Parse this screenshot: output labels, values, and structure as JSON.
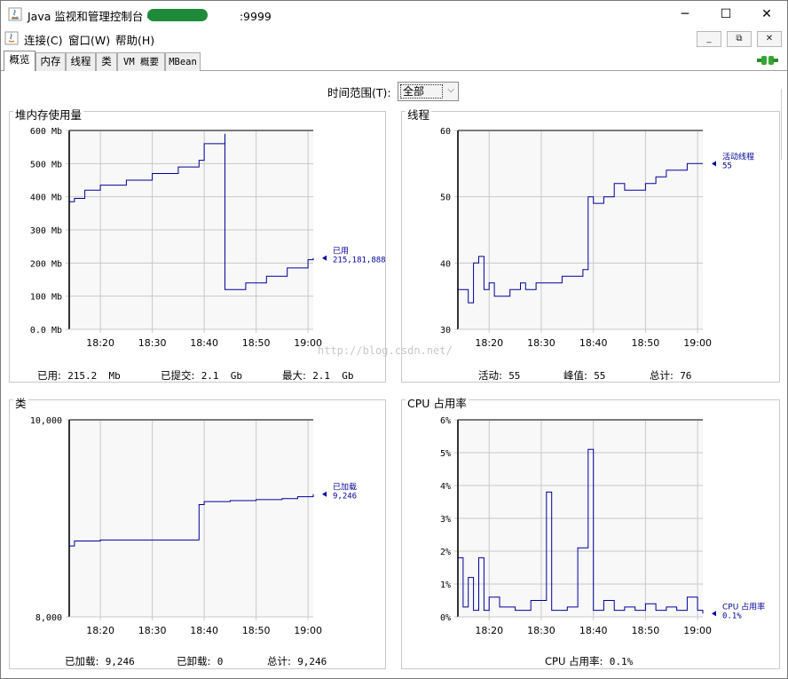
{
  "window": {
    "title": "Java 监视和管理控制台 - ",
    "title_suffix": ":9999",
    "minimize_glyph": "─",
    "maximize_glyph": "☐",
    "close_glyph": "✕"
  },
  "menu": {
    "items": [
      {
        "label": "连接(C)"
      },
      {
        "label": "窗口(W)"
      },
      {
        "label": "帮助(H)"
      }
    ],
    "inner_buttons": [
      "_",
      "⧉",
      "✕"
    ]
  },
  "tabs": [
    {
      "label": "概览",
      "active": true
    },
    {
      "label": "内存",
      "active": false
    },
    {
      "label": "线程",
      "active": false
    },
    {
      "label": "类",
      "active": false
    },
    {
      "label": "VM 概要",
      "active": false
    },
    {
      "label": "MBean",
      "active": false
    }
  ],
  "time_range": {
    "label": "时间范围(T):",
    "value": "全部"
  },
  "watermark": "http://blog.csdn.net/",
  "panels": {
    "heap": {
      "title": "堆内存使用量",
      "stats": [
        {
          "label": "已用:",
          "value": "215.2  Mb"
        },
        {
          "label": "已提交:",
          "value": "2.1  Gb"
        },
        {
          "label": "最大:",
          "value": "2.1  Gb"
        }
      ]
    },
    "threads": {
      "title": "线程",
      "stats": [
        {
          "label": "活动:",
          "value": "55"
        },
        {
          "label": "峰值:",
          "value": "55"
        },
        {
          "label": "总计:",
          "value": "76"
        }
      ]
    },
    "classes": {
      "title": "类",
      "stats": [
        {
          "label": "已加载:",
          "value": "9,246"
        },
        {
          "label": "已卸载:",
          "value": "0"
        },
        {
          "label": "总计:",
          "value": "9,246"
        }
      ]
    },
    "cpu": {
      "title": "CPU 占用率",
      "stats": [
        {
          "label": "CPU 占用率:",
          "value": "0.1%"
        }
      ]
    }
  },
  "chart_data": [
    {
      "type": "line",
      "title": "堆内存使用量",
      "xlabel": "",
      "ylabel": "",
      "x_ticks": [
        "18:20",
        "18:30",
        "18:40",
        "18:50",
        "19:00"
      ],
      "x_range": [
        "18:14",
        "19:01"
      ],
      "y_ticks": [
        "0.0 Mb",
        "100 Mb",
        "200 Mb",
        "300 Mb",
        "400 Mb",
        "500 Mb",
        "600 Mb"
      ],
      "ylim": [
        0,
        600
      ],
      "grid": true,
      "series": [
        {
          "name": "已用",
          "value_label": "215,181,888",
          "color": "#000099",
          "x": [
            "18:14",
            "18:15",
            "18:17",
            "18:20",
            "18:25",
            "18:30",
            "18:35",
            "18:39",
            "18:40",
            "18:44",
            "18:44",
            "18:48",
            "18:52",
            "18:56",
            "19:00",
            "19:01"
          ],
          "y": [
            385,
            395,
            420,
            435,
            450,
            470,
            490,
            510,
            560,
            590,
            120,
            140,
            160,
            185,
            210,
            215
          ]
        }
      ]
    },
    {
      "type": "line",
      "title": "线程",
      "xlabel": "",
      "ylabel": "",
      "x_ticks": [
        "18:20",
        "18:30",
        "18:40",
        "18:50",
        "19:00"
      ],
      "x_range": [
        "18:14",
        "19:01"
      ],
      "y_ticks": [
        "30",
        "40",
        "50",
        "60"
      ],
      "ylim": [
        30,
        60
      ],
      "grid": true,
      "series": [
        {
          "name": "活动线程",
          "value_label": "55",
          "color": "#000099",
          "x": [
            "18:14",
            "18:15",
            "18:16",
            "18:17",
            "18:18",
            "18:19",
            "18:20",
            "18:21",
            "18:22",
            "18:24",
            "18:26",
            "18:27",
            "18:29",
            "18:33",
            "18:34",
            "18:38",
            "18:39",
            "18:40",
            "18:42",
            "18:44",
            "18:46",
            "18:48",
            "18:50",
            "18:52",
            "18:54",
            "18:56",
            "18:58",
            "19:01"
          ],
          "y": [
            36,
            36,
            34,
            40,
            41,
            36,
            37,
            35,
            35,
            36,
            37,
            36,
            37,
            37,
            38,
            39,
            50,
            49,
            50,
            52,
            51,
            51,
            52,
            53,
            54,
            54,
            55,
            55
          ]
        }
      ]
    },
    {
      "type": "line",
      "title": "类",
      "xlabel": "",
      "ylabel": "",
      "x_ticks": [
        "18:20",
        "18:30",
        "18:40",
        "18:50",
        "19:00"
      ],
      "x_range": [
        "18:14",
        "19:01"
      ],
      "y_ticks": [
        "8,000",
        "10,000"
      ],
      "ylim": [
        8000,
        10000
      ],
      "grid": true,
      "series": [
        {
          "name": "已加载",
          "value_label": "9,246",
          "color": "#000099",
          "x": [
            "18:14",
            "18:15",
            "18:20",
            "18:30",
            "18:38",
            "18:39",
            "18:40",
            "18:45",
            "18:50",
            "18:55",
            "18:58",
            "19:01"
          ],
          "y": [
            8720,
            8770,
            8780,
            8780,
            8780,
            9140,
            9170,
            9180,
            9190,
            9200,
            9220,
            9246
          ]
        }
      ]
    },
    {
      "type": "line",
      "title": "CPU 占用率",
      "xlabel": "",
      "ylabel": "",
      "x_ticks": [
        "18:20",
        "18:30",
        "18:40",
        "18:50",
        "19:00"
      ],
      "x_range": [
        "18:14",
        "19:01"
      ],
      "y_ticks": [
        "0%",
        "1%",
        "2%",
        "3%",
        "4%",
        "5%",
        "6%"
      ],
      "ylim": [
        0,
        6
      ],
      "grid": true,
      "series": [
        {
          "name": "CPU 占用率",
          "value_label": "0.1%",
          "color": "#000099",
          "x": [
            "18:14",
            "18:15",
            "18:16",
            "18:17",
            "18:18",
            "18:19",
            "18:20",
            "18:22",
            "18:25",
            "18:28",
            "18:31",
            "18:32",
            "18:35",
            "18:37",
            "18:39",
            "18:40",
            "18:42",
            "18:44",
            "18:46",
            "18:48",
            "18:50",
            "18:52",
            "18:54",
            "18:56",
            "18:58",
            "19:00",
            "19:01"
          ],
          "y": [
            1.8,
            0.3,
            1.2,
            0.2,
            1.8,
            0.2,
            0.6,
            0.3,
            0.2,
            0.5,
            3.8,
            0.2,
            0.3,
            2.1,
            5.1,
            0.2,
            0.5,
            0.2,
            0.3,
            0.2,
            0.4,
            0.2,
            0.3,
            0.2,
            0.6,
            0.2,
            0.1
          ]
        }
      ]
    }
  ]
}
